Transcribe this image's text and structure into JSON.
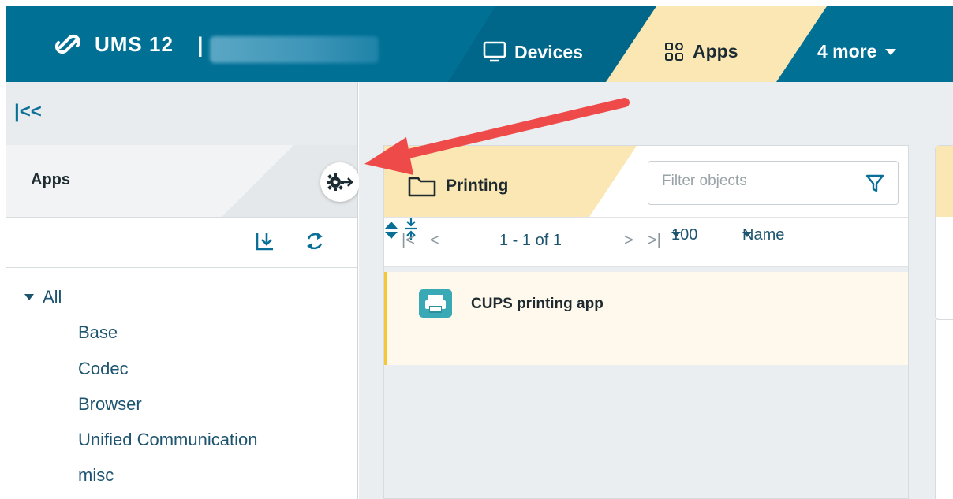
{
  "header": {
    "app_title": "UMS 12",
    "separator": "|",
    "nav": {
      "devices_label": "Devices",
      "apps_label": "Apps",
      "more_label": "4 more"
    }
  },
  "sidebar": {
    "collapse_label": "|<<",
    "section_title": "Apps",
    "tree": {
      "root_label": "All",
      "items": [
        "Base",
        "Codec",
        "Browser",
        "Unified Communication",
        "misc"
      ]
    }
  },
  "main": {
    "folder_title": "Printing",
    "filter": {
      "placeholder": "Filter objects"
    },
    "pager": {
      "range": "1 - 1 of 1",
      "page_size": "100",
      "sort_field": "Name"
    },
    "items": [
      {
        "name": "CUPS printing app"
      }
    ]
  },
  "colors": {
    "header_bg": "#007095",
    "active_tab_bg": "#fbe7b4",
    "selected_row_bg": "#fef9ec",
    "selected_row_accent": "#f5c636",
    "annotation_arrow": "#ee4a4a"
  },
  "icons": {
    "logo": "igel-logo-icon",
    "devices": "monitor-icon",
    "apps": "grid-icon",
    "more": "caret-down-icon",
    "gear": "gear-arrow-icon",
    "import": "import-icon",
    "refresh": "refresh-icon",
    "folder": "folder-icon",
    "filter": "funnel-icon",
    "app": "printer-icon"
  }
}
